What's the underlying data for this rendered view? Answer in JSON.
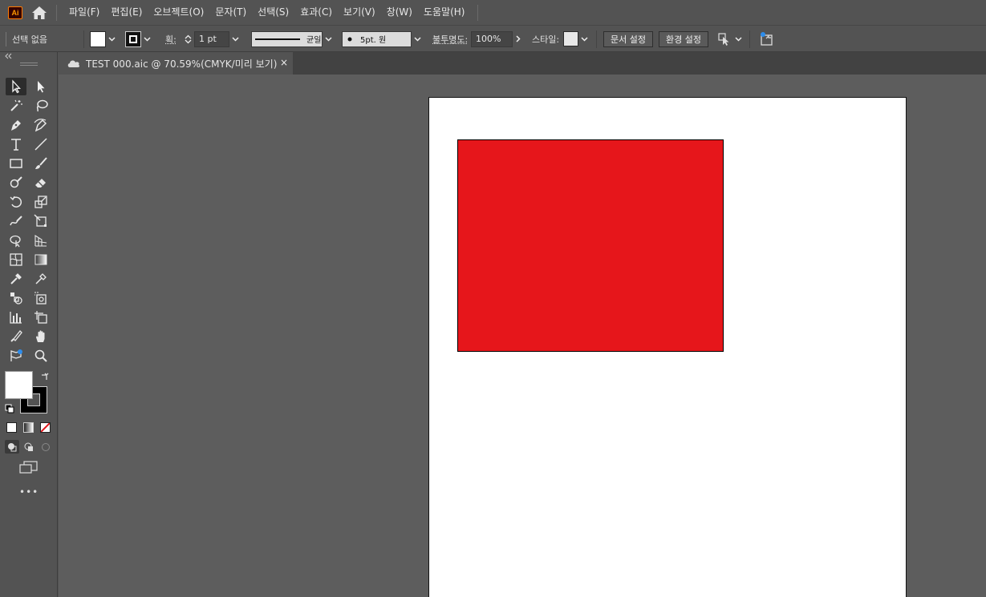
{
  "app": {
    "logo_text": "Ai"
  },
  "menu": {
    "items": [
      "파일(F)",
      "편집(E)",
      "오브젝트(O)",
      "문자(T)",
      "선택(S)",
      "효과(C)",
      "보기(V)",
      "창(W)",
      "도움말(H)"
    ]
  },
  "controlbar": {
    "selection_status": "선택 없음",
    "stroke_label": "획:",
    "stroke_weight": "1 pt",
    "stroke_profile_label": "균일",
    "brush_label": "5pt. 원",
    "opacity_label": "불투명도:",
    "opacity_value": "100%",
    "style_label": "스타일:",
    "document_setup_button": "문서 설정",
    "preferences_button": "환경 설정"
  },
  "document": {
    "tab_title": "TEST 000.aic @ 70.59%(CMYK/미리 보기)",
    "close_glyph": "×"
  },
  "colors": {
    "fill": "#ffffff",
    "stroke": "#000000",
    "shape_fill": "#e6161b",
    "ui_bg": "#535353",
    "canvas_bg": "#5d5d5d"
  },
  "toolbar": {
    "more_tools_glyph": "•••",
    "tools": [
      "selection-tool",
      "direct-selection-tool",
      "magic-wand-tool",
      "lasso-tool",
      "pen-tool",
      "curvature-tool",
      "type-tool",
      "line-segment-tool",
      "rectangle-tool",
      "paintbrush-tool",
      "shaper-tool",
      "eraser-tool",
      "rotate-tool",
      "scale-tool",
      "warp-tool",
      "free-transform-tool",
      "shape-builder-tool",
      "perspective-grid-tool",
      "mesh-tool",
      "gradient-tool",
      "eyedropper-tool",
      "blend-tool",
      "symbol-sprayer-tool",
      "artboard-tool-alt",
      "column-graph-tool",
      "artboard-tool",
      "slice-tool",
      "hand-tool",
      "puppet-warp-tool",
      "zoom-tool"
    ]
  }
}
